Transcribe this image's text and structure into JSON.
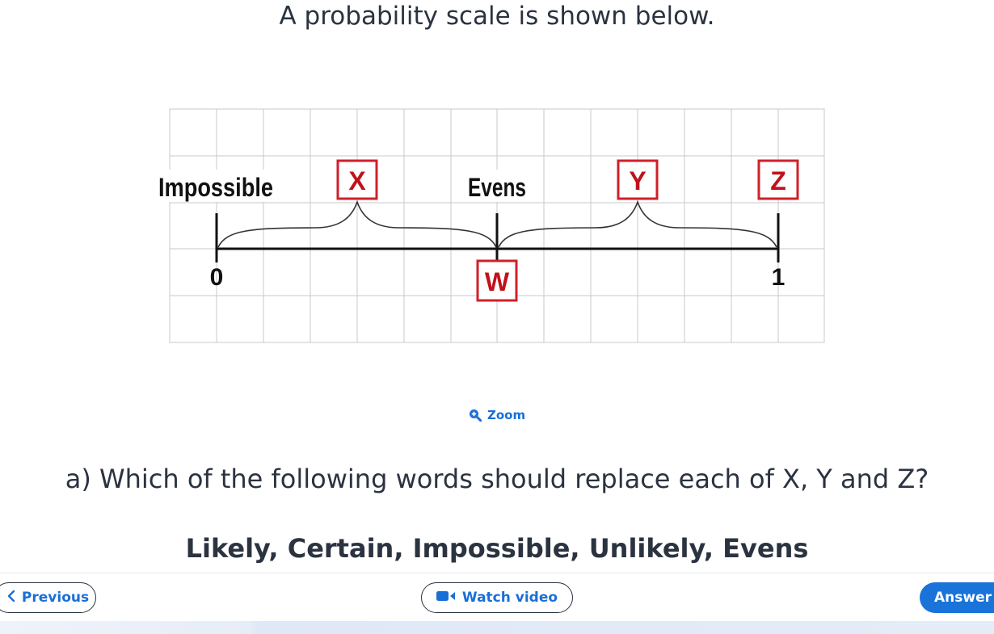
{
  "intro": "A probability scale is shown below.",
  "diagram": {
    "label_impossible": "Impossible",
    "label_evens": "Evens",
    "tick_zero": "0",
    "tick_one": "1",
    "box_x": "X",
    "box_y": "Y",
    "box_z": "Z",
    "box_w": "W"
  },
  "zoom": {
    "label": "Zoom",
    "icon": "zoom-in-icon"
  },
  "question": "a) Which of the following words should replace each of X, Y and Z?",
  "options": "Likely, Certain, Impossible, Unlikely, Evens",
  "nav": {
    "previous": "Previous",
    "previous_icon": "chevron-left-icon",
    "watch_video": "Watch video",
    "watch_video_icon": "video-camera-icon",
    "answer": "Answer"
  },
  "colors": {
    "accent": "#1a6fd6",
    "answer_button": "#1a73d9",
    "box_red": "#d0202a",
    "text": "#2b3340"
  }
}
